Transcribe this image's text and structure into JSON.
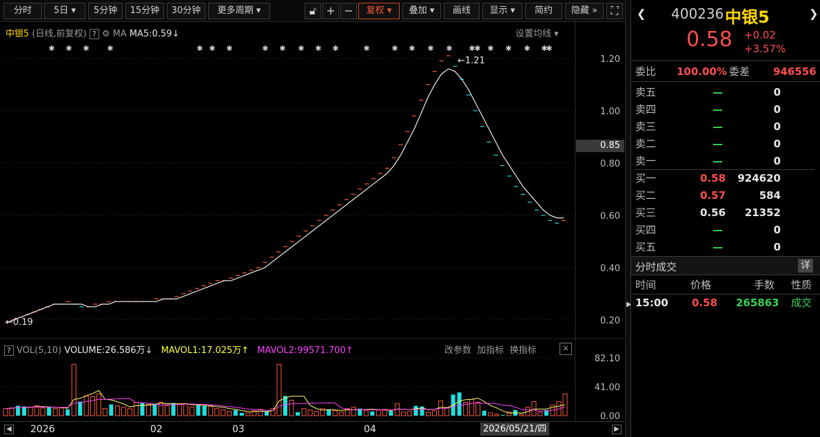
{
  "toolbar": {
    "items": [
      "分时",
      "5日",
      "5分钟",
      "15分钟",
      "30分钟",
      "更多周期"
    ],
    "icons": [
      "lock-icon",
      "plus-icon",
      "minus-icon"
    ],
    "fuquan": "复权",
    "overlay": "叠加",
    "draw": "画线",
    "display": "显示",
    "simple": "简约",
    "hide": "隐藏"
  },
  "chart_header": {
    "name": "中银5",
    "mode": "(日线,前复权)",
    "help": "?",
    "ma_label": "MA",
    "ma5": "MA5:0.59",
    "ma5_arrow": "↓",
    "settings": "设置均线"
  },
  "price_axis": {
    "ticks": [
      "1.20",
      "1.00",
      "0.80",
      "0.60",
      "0.40",
      "0.20"
    ],
    "current": "0.85"
  },
  "annotations": {
    "high": "1.21",
    "low": "0.19"
  },
  "volume_header": {
    "help": "?",
    "label": "VOL(5,10)",
    "volume": "VOLUME:26.586万",
    "volume_arrow": "↓",
    "mavol1": "MAVOL1:17.025万",
    "mavol1_arrow": "↑",
    "mavol2": "MAVOL2:99571.700",
    "mavol2_arrow": "↑",
    "btn_params": "改参数",
    "btn_add": "加指标",
    "btn_switch": "换指标",
    "close": "✕"
  },
  "volume_axis": {
    "ticks": [
      "82.10",
      "41.00",
      "0.00"
    ]
  },
  "date_axis": {
    "labels": [
      "2026",
      "02",
      "03",
      "04"
    ],
    "cursor": "2026/05/21/四"
  },
  "quote": {
    "code": "400236",
    "name": "中银5",
    "price": "0.58",
    "change": "+0.02",
    "change_pct": "+3.57%",
    "weibi_label": "委比",
    "weibi": "100.00%",
    "weicha_label": "委差",
    "weicha": "946556",
    "asks": [
      {
        "label": "卖五",
        "price": "—",
        "vol": "0"
      },
      {
        "label": "卖四",
        "price": "—",
        "vol": "0"
      },
      {
        "label": "卖三",
        "price": "—",
        "vol": "0"
      },
      {
        "label": "卖二",
        "price": "—",
        "vol": "0"
      },
      {
        "label": "卖一",
        "price": "—",
        "vol": "0"
      }
    ],
    "bids": [
      {
        "label": "买一",
        "price": "0.58",
        "vol": "924620"
      },
      {
        "label": "买二",
        "price": "0.57",
        "vol": "584"
      },
      {
        "label": "买三",
        "price": "0.56",
        "vol": "21352"
      },
      {
        "label": "买四",
        "price": "—",
        "vol": "0"
      },
      {
        "label": "买五",
        "price": "—",
        "vol": "0"
      }
    ],
    "trades_title": "分时成交",
    "trades_detail": "详",
    "trades_headers": [
      "时间",
      "价格",
      "手数",
      "性质"
    ],
    "trades": [
      {
        "time": "15:00",
        "price": "0.58",
        "vol": "265863",
        "type": "成交"
      }
    ]
  },
  "chart_data": {
    "type": "line",
    "price_range": [
      0.16,
      1.26
    ],
    "volume_range": [
      0,
      82.1
    ],
    "price_ticks": [
      1.2,
      1.0,
      0.8,
      0.6,
      0.4,
      0.2
    ],
    "high": 1.21,
    "low": 0.19,
    "close_series": [
      0.19,
      0.2,
      0.21,
      0.22,
      0.23,
      0.24,
      0.25,
      0.26,
      0.26,
      0.27,
      0.26,
      0.25,
      0.25,
      0.26,
      0.26,
      0.27,
      0.27,
      0.27,
      0.27,
      0.27,
      0.27,
      0.27,
      0.28,
      0.28,
      0.28,
      0.29,
      0.3,
      0.31,
      0.32,
      0.33,
      0.34,
      0.35,
      0.35,
      0.36,
      0.37,
      0.38,
      0.39,
      0.4,
      0.42,
      0.44,
      0.46,
      0.48,
      0.5,
      0.52,
      0.54,
      0.56,
      0.58,
      0.6,
      0.62,
      0.64,
      0.66,
      0.68,
      0.7,
      0.72,
      0.74,
      0.76,
      0.78,
      0.82,
      0.87,
      0.92,
      0.98,
      1.04,
      1.1,
      1.15,
      1.19,
      1.21,
      1.17,
      1.12,
      1.06,
      1.0,
      0.94,
      0.88,
      0.83,
      0.79,
      0.75,
      0.71,
      0.68,
      0.65,
      0.62,
      0.6,
      0.58,
      0.57,
      0.58
    ],
    "ma5_series": [
      0.19,
      0.2,
      0.21,
      0.22,
      0.23,
      0.24,
      0.25,
      0.26,
      0.26,
      0.26,
      0.26,
      0.26,
      0.25,
      0.25,
      0.26,
      0.26,
      0.27,
      0.27,
      0.27,
      0.27,
      0.27,
      0.27,
      0.27,
      0.28,
      0.28,
      0.28,
      0.29,
      0.3,
      0.31,
      0.32,
      0.33,
      0.34,
      0.35,
      0.35,
      0.36,
      0.37,
      0.38,
      0.39,
      0.4,
      0.42,
      0.44,
      0.46,
      0.48,
      0.5,
      0.52,
      0.54,
      0.56,
      0.58,
      0.6,
      0.62,
      0.64,
      0.66,
      0.68,
      0.7,
      0.72,
      0.74,
      0.76,
      0.79,
      0.83,
      0.88,
      0.93,
      0.99,
      1.05,
      1.1,
      1.14,
      1.16,
      1.15,
      1.12,
      1.08,
      1.03,
      0.98,
      0.93,
      0.88,
      0.83,
      0.79,
      0.75,
      0.71,
      0.68,
      0.65,
      0.62,
      0.6,
      0.59,
      0.59
    ],
    "volume_series": [
      10,
      11,
      14,
      13,
      12,
      14,
      11,
      12,
      10,
      11,
      9,
      73,
      20,
      28,
      27,
      31,
      10,
      16,
      14,
      12,
      10,
      19,
      18,
      16,
      17,
      19,
      14,
      18,
      16,
      17,
      12,
      15,
      14,
      13,
      10,
      8,
      6,
      8,
      4,
      4,
      7,
      9,
      6,
      10,
      73,
      28,
      22,
      5,
      10,
      8,
      6,
      10,
      9,
      7,
      5,
      10,
      12,
      10,
      7,
      6,
      8,
      9,
      7,
      17,
      5,
      6,
      14,
      13,
      5,
      7,
      21,
      11,
      30,
      33,
      19,
      23,
      19,
      7,
      4,
      2,
      1,
      5,
      8,
      2,
      12,
      20,
      5,
      8,
      15,
      20,
      31
    ],
    "grid": true
  }
}
